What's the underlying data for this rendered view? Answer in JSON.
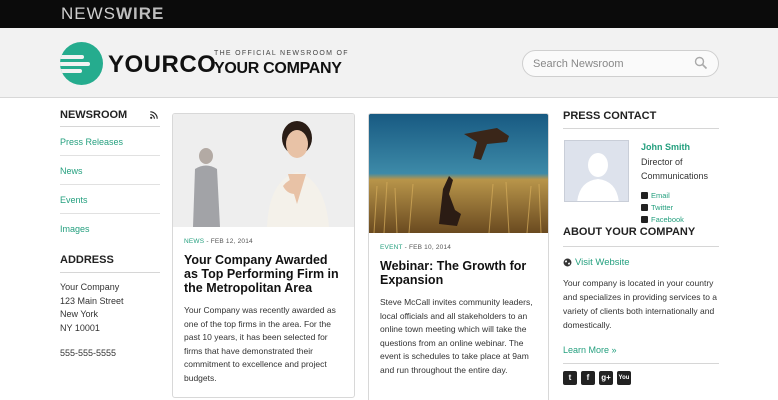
{
  "brand": {
    "newswire_a": "NEWS",
    "newswire_b": "WIRE"
  },
  "header": {
    "logo_text": "YOURCO",
    "tagline_small": "THE OFFICIAL NEWSROOM OF",
    "tagline_big": "YOUR COMPANY",
    "search_placeholder": "Search Newsroom",
    "accent": "#25ac8e"
  },
  "sidebar": {
    "heading": "NEWSROOM",
    "items": [
      {
        "label": "Press Releases"
      },
      {
        "label": "News"
      },
      {
        "label": "Events"
      },
      {
        "label": "Images"
      }
    ],
    "address_heading": "ADDRESS",
    "address_lines": [
      "Your Company",
      "123 Main Street",
      "New York",
      "NY 10001"
    ],
    "phone": "555-555-5555"
  },
  "cards": [
    {
      "category": "NEWS",
      "date": " - FEB 12, 2014",
      "title": "Your Company Awarded as Top Performing Firm in the Metropolitan Area",
      "body": "Your Company was recently awarded as one of the top firms in the area. For the past 10 years, it has been selected for firms that have demonstrated their commitment to excellence and project budgets."
    },
    {
      "category": "EVENT",
      "date": " - FEB 10, 2014",
      "title": "Webinar: The Growth for Expansion",
      "body": "Steve McCall invites community leaders, local officials and all stakeholders to an online town meeting which will take the questions from an online webinar. The event is schedules to take place at 9am and run throughout the entire day."
    }
  ],
  "press_contact": {
    "heading": "PRESS CONTACT",
    "name": "John Smith",
    "role": "Director of Communications",
    "links": [
      {
        "label": "Email",
        "icon": "email-icon"
      },
      {
        "label": "Twitter",
        "icon": "twitter-icon"
      },
      {
        "label": "Facebook",
        "icon": "facebook-icon"
      }
    ]
  },
  "about": {
    "heading": "ABOUT YOUR COMPANY",
    "visit_label": "Visit Website",
    "text": "Your company is located in your country and specializes in providing services to a variety of clients both internationally and domestically.",
    "learn_more": "Learn More »",
    "social_icons": [
      "twitter-icon",
      "facebook-icon",
      "google-plus-icon",
      "youtube-icon"
    ]
  }
}
